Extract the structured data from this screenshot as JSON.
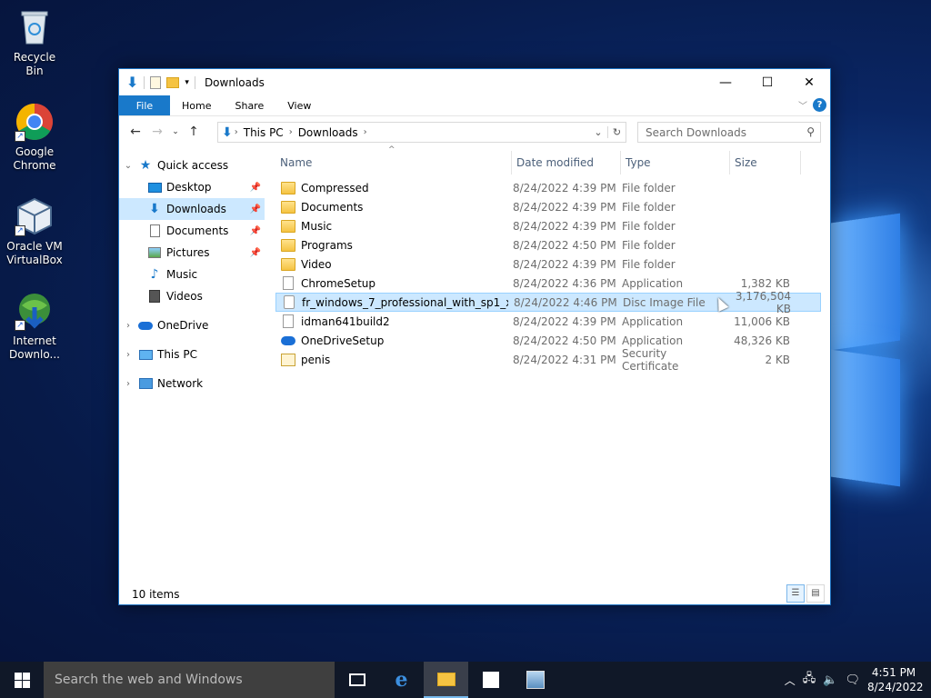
{
  "desktop": {
    "icons": [
      {
        "label": "Recycle Bin"
      },
      {
        "label": "Google Chrome"
      },
      {
        "label": "Oracle VM VirtualBox"
      },
      {
        "label": "Internet Downlo..."
      }
    ]
  },
  "window": {
    "title": "Downloads",
    "ribbon_tabs": [
      "File",
      "Home",
      "Share",
      "View"
    ],
    "address": {
      "crumbs": [
        "This PC",
        "Downloads"
      ]
    },
    "search_placeholder": "Search Downloads",
    "sidebar": {
      "quick_access": "Quick access",
      "items": [
        "Desktop",
        "Downloads",
        "Documents",
        "Pictures",
        "Music",
        "Videos"
      ],
      "onedrive": "OneDrive",
      "thispc": "This PC",
      "network": "Network"
    },
    "columns": [
      "Name",
      "Date modified",
      "Type",
      "Size"
    ],
    "files": [
      {
        "name": "Compressed",
        "date": "8/24/2022 4:39 PM",
        "type": "File folder",
        "size": "",
        "icon": "folder-icon"
      },
      {
        "name": "Documents",
        "date": "8/24/2022 4:39 PM",
        "type": "File folder",
        "size": "",
        "icon": "folder-icon"
      },
      {
        "name": "Music",
        "date": "8/24/2022 4:39 PM",
        "type": "File folder",
        "size": "",
        "icon": "folder-icon"
      },
      {
        "name": "Programs",
        "date": "8/24/2022 4:50 PM",
        "type": "File folder",
        "size": "",
        "icon": "folder-icon"
      },
      {
        "name": "Video",
        "date": "8/24/2022 4:39 PM",
        "type": "File folder",
        "size": "",
        "icon": "folder-icon"
      },
      {
        "name": "ChromeSetup",
        "date": "8/24/2022 4:36 PM",
        "type": "Application",
        "size": "1,382 KB",
        "icon": "app-icon"
      },
      {
        "name": "fr_windows_7_professional_with_sp1_x64...",
        "date": "8/24/2022 4:46 PM",
        "type": "Disc Image File",
        "size": "3,176,504 KB",
        "icon": "disc-image-icon"
      },
      {
        "name": "idman641build2",
        "date": "8/24/2022 4:39 PM",
        "type": "Application",
        "size": "11,006 KB",
        "icon": "app-icon"
      },
      {
        "name": "OneDriveSetup",
        "date": "8/24/2022 4:50 PM",
        "type": "Application",
        "size": "48,326 KB",
        "icon": "onedrive-icon"
      },
      {
        "name": "penis",
        "date": "8/24/2022 4:31 PM",
        "type": "Security Certificate",
        "size": "2 KB",
        "icon": "certificate-icon"
      }
    ],
    "status": "10 items"
  },
  "taskbar": {
    "search_placeholder": "Search the web and Windows",
    "time": "4:51 PM",
    "date": "8/24/2022"
  }
}
